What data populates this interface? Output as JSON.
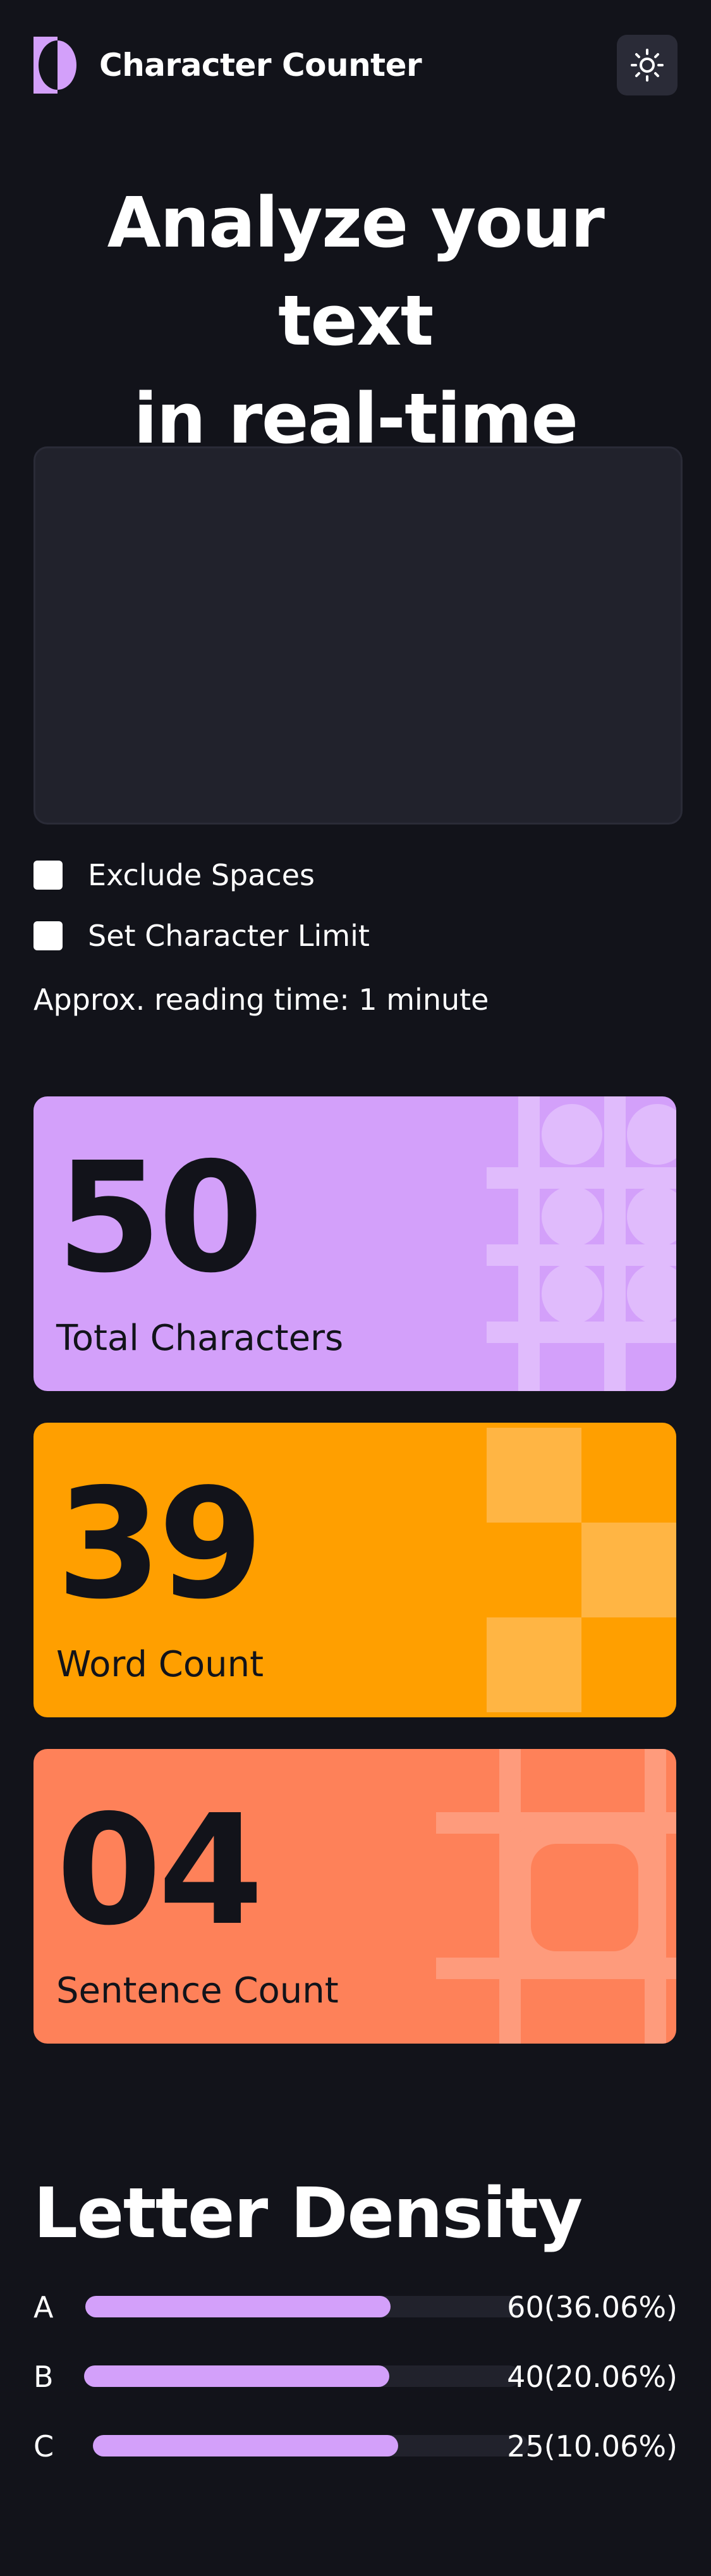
{
  "app": {
    "title": "Character Counter",
    "logo_icon": "half-circle-logo-icon",
    "theme_icon": "sun-icon"
  },
  "hero": {
    "line1": "Analyze your text",
    "line2": "in real-time"
  },
  "input": {
    "value": "",
    "placeholder": ""
  },
  "options": {
    "exclude_spaces": {
      "label": "Exclude Spaces",
      "checked": false
    },
    "char_limit": {
      "label": "Set Character Limit",
      "checked": false
    }
  },
  "reading_time": "Approx. reading time: 1 minute",
  "stats": {
    "characters": {
      "value": "50",
      "label": "Total Characters"
    },
    "words": {
      "value": "39",
      "label": "Word Count"
    },
    "sentences": {
      "value": "04",
      "label": "Sentence Count"
    }
  },
  "density": {
    "title": "Letter Density",
    "rows": [
      {
        "letter": "A",
        "count_label": "60(36.06%)",
        "fill": 0.7
      },
      {
        "letter": "B",
        "count_label": "40(20.06%)",
        "fill": 0.7
      },
      {
        "letter": "C",
        "count_label": "25(10.06%)",
        "fill": 0.7
      }
    ]
  },
  "colors": {
    "background": "#12131a",
    "surface": "#21222c",
    "accent_purple": "#d3a0fa",
    "accent_orange": "#ff9f00",
    "accent_coral": "#fe8159",
    "text_dark": "#12131a"
  }
}
